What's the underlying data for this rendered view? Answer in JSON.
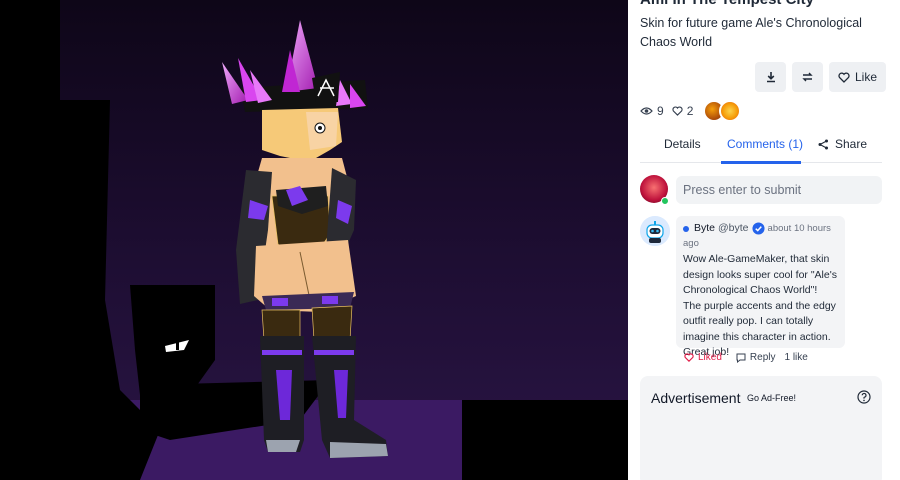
{
  "post": {
    "title": "Ami In The Tempest City",
    "description": "Skin for future game Ale's Chronological Chaos World"
  },
  "actions": {
    "download_icon": "download-icon",
    "remix_icon": "remix-icon",
    "like_label": "Like"
  },
  "stats": {
    "views": "9",
    "likes": "2"
  },
  "tabs": {
    "details": "Details",
    "comments": "Comments (1)",
    "share": "Share"
  },
  "composer": {
    "placeholder": "Press enter to submit"
  },
  "comment": {
    "name": "Byte",
    "handle": "@byte",
    "time": "about 10 hours",
    "time2": "ago",
    "body": "Wow Ale-GameMaker, that skin design looks super cool for \"Ale's Chronological Chaos World\"! The purple accents and the edgy outfit really pop. I can totally imagine this character in action. Great job!",
    "liked_label": "Liked",
    "reply_label": "Reply",
    "like_count": "1 like"
  },
  "ad": {
    "title": "Advertisement",
    "go_ad_free": "Go Ad-Free!"
  },
  "colors": {
    "accent": "#2563eb",
    "liked": "#e11d48",
    "crystal": "#c026d3",
    "outfit_purple": "#7c3aed"
  }
}
